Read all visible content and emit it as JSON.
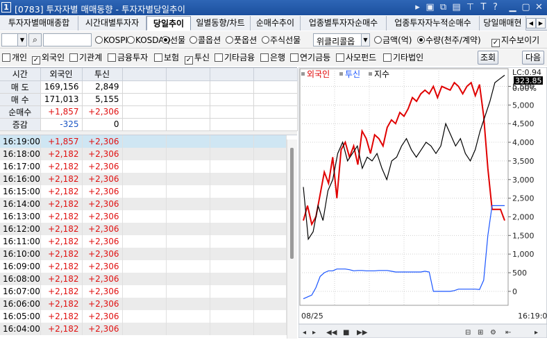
{
  "title_bar": {
    "number": "1",
    "title": "[0783] 투자자별 매매동향 - 투자자별당일추이"
  },
  "tabs": [
    {
      "label": "투자자별매매종합"
    },
    {
      "label": "시간대별투자자"
    },
    {
      "label": "당일추이",
      "active": true
    },
    {
      "label": "일별동향/차트"
    },
    {
      "label": "순매수추이"
    },
    {
      "label": "업종별투자자순매수"
    },
    {
      "label": "업종투자자누적순매수"
    },
    {
      "label": "당일매매현"
    }
  ],
  "controls": {
    "market_options": [
      {
        "label": "KOSPI",
        "selected": false
      },
      {
        "label": "KOSDAQ",
        "selected": false
      },
      {
        "label": "선물",
        "selected": true
      },
      {
        "label": "콜옵션",
        "selected": false
      },
      {
        "label": "풋옵션",
        "selected": false
      },
      {
        "label": "주식선물",
        "selected": false
      }
    ],
    "weekly_select": "위클리콜옵",
    "unit_options": [
      {
        "label": "금액(억)",
        "selected": false
      },
      {
        "label": "수량(천주/계약)",
        "selected": true
      }
    ],
    "show_index": {
      "label": "지수보이기",
      "checked": true
    }
  },
  "investors": [
    {
      "label": "개인",
      "checked": false
    },
    {
      "label": "외국인",
      "checked": true
    },
    {
      "label": "기관계",
      "checked": false
    },
    {
      "label": "금융투자",
      "checked": false
    },
    {
      "label": "보험",
      "checked": false
    },
    {
      "label": "투신",
      "checked": true
    },
    {
      "label": "기타금융",
      "checked": false
    },
    {
      "label": "은행",
      "checked": false
    },
    {
      "label": "연기금등",
      "checked": false
    },
    {
      "label": "사모펀드",
      "checked": false
    },
    {
      "label": "기타법인",
      "checked": false
    }
  ],
  "buttons": {
    "search": "조회",
    "next": "다음"
  },
  "summary": {
    "headers": [
      "시간",
      "외국인",
      "투신"
    ],
    "rows": [
      {
        "label": "매 도",
        "foreign": "169,156",
        "trust": "2,849"
      },
      {
        "label": "매 수",
        "foreign": "171,013",
        "trust": "5,155"
      },
      {
        "label": "순매수",
        "foreign": "+1,857",
        "trust": "+2,306"
      },
      {
        "label": "증감",
        "foreign": "-325",
        "trust": "0"
      }
    ]
  },
  "time_rows": [
    {
      "time": "16:19:00",
      "foreign": "+1,857",
      "trust": "+2,306"
    },
    {
      "time": "16:18:00",
      "foreign": "+2,182",
      "trust": "+2,306"
    },
    {
      "time": "16:17:00",
      "foreign": "+2,182",
      "trust": "+2,306"
    },
    {
      "time": "16:16:00",
      "foreign": "+2,182",
      "trust": "+2,306"
    },
    {
      "time": "16:15:00",
      "foreign": "+2,182",
      "trust": "+2,306"
    },
    {
      "time": "16:14:00",
      "foreign": "+2,182",
      "trust": "+2,306"
    },
    {
      "time": "16:13:00",
      "foreign": "+2,182",
      "trust": "+2,306"
    },
    {
      "time": "16:12:00",
      "foreign": "+2,182",
      "trust": "+2,306"
    },
    {
      "time": "16:11:00",
      "foreign": "+2,182",
      "trust": "+2,306"
    },
    {
      "time": "16:10:00",
      "foreign": "+2,182",
      "trust": "+2,306"
    },
    {
      "time": "16:09:00",
      "foreign": "+2,182",
      "trust": "+2,306"
    },
    {
      "time": "16:08:00",
      "foreign": "+2,182",
      "trust": "+2,306"
    },
    {
      "time": "16:07:00",
      "foreign": "+2,182",
      "trust": "+2,306"
    },
    {
      "time": "16:06:00",
      "foreign": "+2,182",
      "trust": "+2,306"
    },
    {
      "time": "16:05:00",
      "foreign": "+2,182",
      "trust": "+2,306"
    },
    {
      "time": "16:04:00",
      "foreign": "+2,182",
      "trust": "+2,306"
    }
  ],
  "chart": {
    "legend": [
      {
        "name": "외국인",
        "color": "#e00000"
      },
      {
        "name": "투신",
        "color": "#1a55ff"
      },
      {
        "name": "지수",
        "color": "#000000"
      }
    ],
    "index_axis_top": "LC:0.94",
    "index_axis_pct": "0.00%",
    "current_value": "323.85",
    "y_ticks": [
      "5,500",
      "5,000",
      "4,500",
      "4,000",
      "3,500",
      "3,000",
      "2,500",
      "2,000",
      "1,500",
      "1,000",
      "500",
      "0"
    ],
    "x_start": "08/25",
    "x_end": "16:19:0"
  },
  "chart_data": {
    "type": "line",
    "ylim": [
      -300,
      5900
    ],
    "series": [
      {
        "name": "외국인",
        "color": "#e00000",
        "values": [
          1900,
          2300,
          1800,
          2000,
          2600,
          3200,
          2900,
          3600,
          2500,
          3800,
          4000,
          3600,
          3900,
          3400,
          4300,
          4100,
          3700,
          4200,
          4100,
          3900,
          4400,
          4600,
          4500,
          4800,
          4700,
          4900,
          5200,
          5100,
          5300,
          5400,
          5300,
          5500,
          5200,
          5500,
          5450,
          5400,
          5600,
          5500,
          5300,
          5500,
          5600,
          5250,
          5550,
          4700,
          3300,
          2200,
          2200,
          2200,
          1900
        ]
      },
      {
        "name": "투신",
        "color": "#1a55ff",
        "values": [
          -200,
          -150,
          -100,
          100,
          400,
          500,
          550,
          550,
          600,
          600,
          600,
          580,
          550,
          560,
          560,
          550,
          550,
          550,
          560,
          560,
          560,
          540,
          520,
          520,
          520,
          520,
          520,
          520,
          520,
          540,
          520,
          0,
          0,
          0,
          0,
          0,
          20,
          60,
          60,
          60,
          60,
          60,
          50,
          300,
          1500,
          2300,
          2300,
          2300,
          2300
        ]
      },
      {
        "name": "지수",
        "color": "#000000",
        "values": [
          2800,
          1400,
          1600,
          2300,
          1900,
          2700,
          3000,
          3700,
          4000,
          3500,
          3700,
          3900,
          3300,
          3600,
          3500,
          3700,
          3300,
          3000,
          3500,
          3600,
          3900,
          4100,
          3800,
          3600,
          3800,
          4000,
          3900,
          3700,
          3900,
          4500,
          4200,
          3900,
          4100,
          3700,
          3500,
          3800,
          4300,
          4700,
          5100,
          5600,
          5700,
          5800
        ]
      }
    ]
  }
}
